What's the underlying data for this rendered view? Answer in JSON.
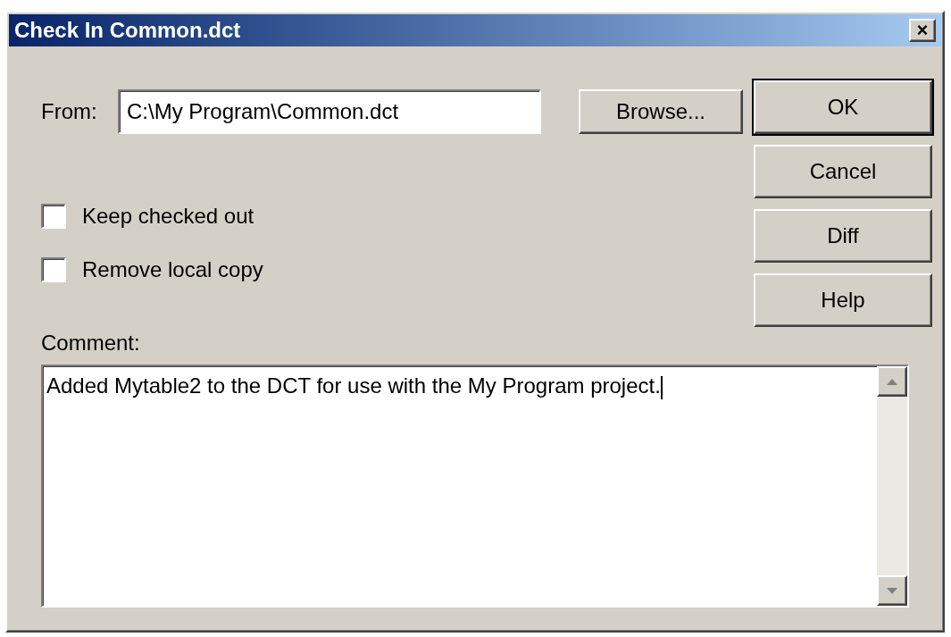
{
  "window": {
    "title": "Check In Common.dct",
    "close": "×"
  },
  "from": {
    "label": "From:",
    "value": "C:\\My Program\\Common.dct",
    "browse": "Browse..."
  },
  "buttons": [
    {
      "label": "OK",
      "default": true
    },
    {
      "label": "Cancel",
      "default": false
    },
    {
      "label": "Diff",
      "default": false
    },
    {
      "label": "Help",
      "default": false
    }
  ],
  "options": [
    {
      "label": "Keep checked out",
      "checked": false
    },
    {
      "label": "Remove local copy",
      "checked": false
    }
  ],
  "comment": {
    "label": "Comment:",
    "value": "Added Mytable2 to the DCT for use with the My Program project."
  }
}
